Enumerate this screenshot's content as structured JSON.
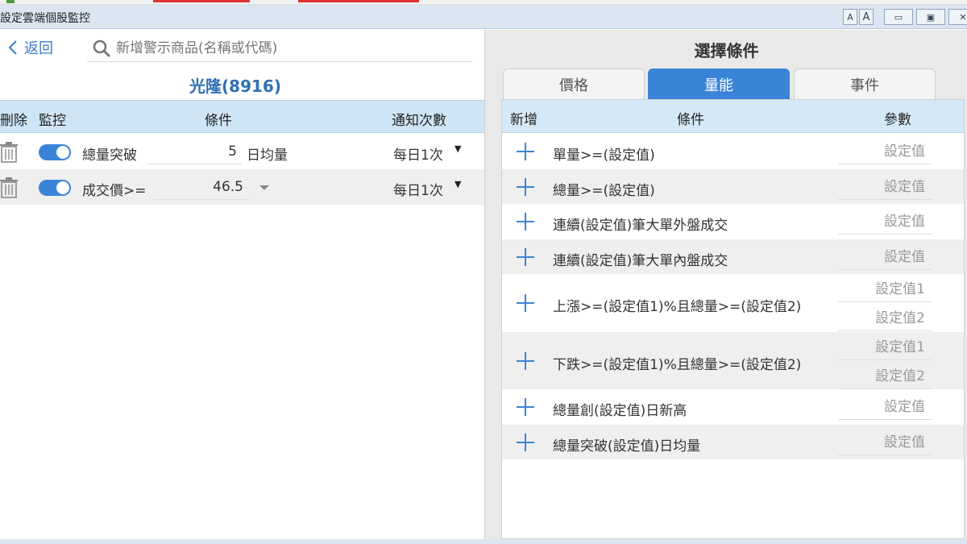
{
  "window": {
    "title": "設定雲端個股監控",
    "font_smaller": "A",
    "font_larger": "A",
    "minimize": "▭",
    "maximize": "▣",
    "close": "✕"
  },
  "left": {
    "back_label": "返回",
    "search_placeholder": "新增警示商品(名稱或代碼)",
    "stock_title": "光隆(8916)",
    "headers": {
      "delete": "刪除",
      "monitor": "監控",
      "condition": "條件",
      "notify": "通知次數"
    },
    "rows": [
      {
        "name": "總量突破",
        "value": "5",
        "suffix": "日均量",
        "frequency": "每日1次",
        "enabled": true
      },
      {
        "name": "成交價>=",
        "value": "46.5",
        "suffix": "",
        "frequency": "每日1次",
        "enabled": true
      }
    ]
  },
  "right": {
    "title": "選擇條件",
    "tabs": [
      {
        "label": "價格",
        "active": false
      },
      {
        "label": "量能",
        "active": true
      },
      {
        "label": "事件",
        "active": false
      }
    ],
    "headers": {
      "add": "新增",
      "condition": "條件",
      "params": "參數"
    },
    "rows": [
      {
        "condition": "單量>=(設定值)",
        "params": [
          "設定值"
        ]
      },
      {
        "condition": "總量>=(設定值)",
        "params": [
          "設定值"
        ]
      },
      {
        "condition": "連續(設定值)筆大單外盤成交",
        "params": [
          "設定值"
        ]
      },
      {
        "condition": "連續(設定值)筆大單內盤成交",
        "params": [
          "設定值"
        ]
      },
      {
        "condition": "上漲>=(設定值1)%且總量>=(設定值2)",
        "params": [
          "設定值1",
          "設定值2"
        ]
      },
      {
        "condition": "下跌>=(設定值1)%且總量>=(設定值2)",
        "params": [
          "設定值1",
          "設定值2"
        ]
      },
      {
        "condition": "總量創(設定值)日新高",
        "params": [
          "設定值"
        ]
      },
      {
        "condition": "總量突破(設定值)日均量",
        "params": [
          "設定值"
        ]
      }
    ]
  },
  "colors": {
    "accent": "#3a84d8",
    "header_bg": "#cfe5f6",
    "title_blue": "#2f6fb5"
  }
}
